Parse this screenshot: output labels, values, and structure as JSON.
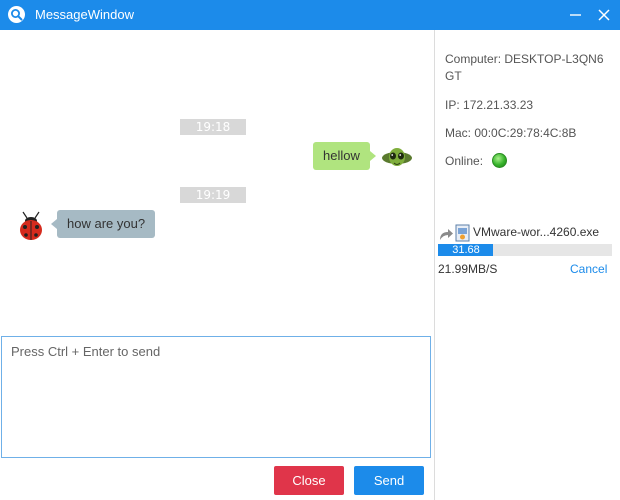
{
  "window": {
    "title": "MessageWindow"
  },
  "colors": {
    "titlebar": "#1c8bea",
    "outgoing_bubble": "#b0e47f",
    "incoming_bubble": "#a6bac4",
    "close_button": "#e0354a",
    "send_button": "#1c8bea",
    "progress_fill": "#1c8bea",
    "online_status": "#36b32b"
  },
  "messages": [
    {
      "type": "timestamp",
      "text": "19:18"
    },
    {
      "type": "outgoing",
      "text": "hellow",
      "avatar": "alien-avatar-icon"
    },
    {
      "type": "timestamp",
      "text": "19:19"
    },
    {
      "type": "incoming",
      "text": "how are you?",
      "avatar": "ladybug-avatar-icon"
    }
  ],
  "composer": {
    "placeholder": "Press Ctrl + Enter to send",
    "value": ""
  },
  "buttons": {
    "close_label": "Close",
    "send_label": "Send"
  },
  "info": {
    "computer_label": "Computer:",
    "computer_value_line1": "DESKTOP-L3QN6",
    "computer_value_line2": "GT",
    "ip_label": "IP:",
    "ip_value": "172.21.33.23",
    "mac_label": "Mac:",
    "mac_value": "00:0C:29:78:4C:8B",
    "online_label": "Online:",
    "online_status_icon": "green-dot-icon"
  },
  "transfer": {
    "file_name": "VMware-wor...4260.exe",
    "progress_percent": 31.68,
    "progress_text": "31.68",
    "speed": "21.99MB/S",
    "cancel_label": "Cancel",
    "icons": [
      "transfer-arrow-icon",
      "file-icon"
    ]
  }
}
